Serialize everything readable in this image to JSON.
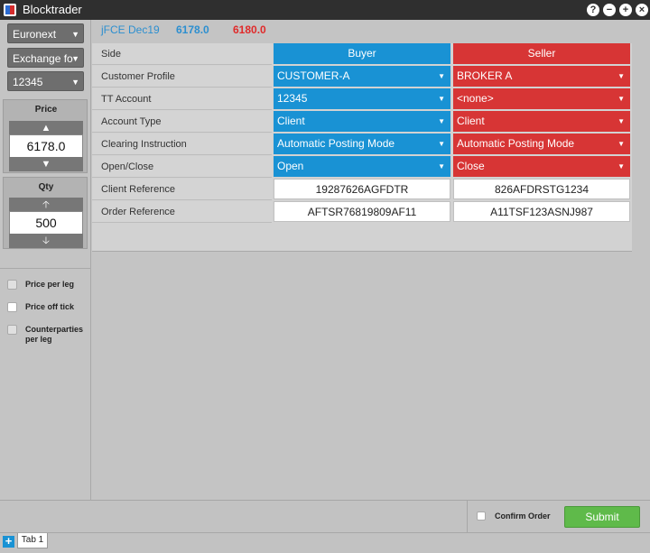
{
  "window": {
    "title": "Blocktrader",
    "controls": [
      "?",
      "−",
      "+",
      "×"
    ]
  },
  "sidebar": {
    "exchange_select": "Euronext",
    "type_select": "Exchange fo",
    "account_select": "12345",
    "price_label": "Price",
    "price_value": "6178.0",
    "qty_label": "Qty",
    "qty_value": "500",
    "options": [
      {
        "label": "Price per leg",
        "checked": false
      },
      {
        "label": "Price off tick",
        "checked": false
      },
      {
        "label": "Counterparties per leg",
        "checked": false
      }
    ]
  },
  "instrument": {
    "name": "jFCE Dec19",
    "bid": "6178.0",
    "ask": "6180.0"
  },
  "form": {
    "side_label": "Side",
    "buyer_header": "Buyer",
    "seller_header": "Seller",
    "rows": [
      {
        "label": "Customer Profile",
        "buyer": "CUSTOMER-A",
        "seller": "BROKER A"
      },
      {
        "label": "TT Account",
        "buyer": "12345",
        "seller": "<none>"
      },
      {
        "label": "Account Type",
        "buyer": "Client",
        "seller": "Client"
      },
      {
        "label": "Clearing Instruction",
        "buyer": "Automatic Posting Mode",
        "seller": "Automatic Posting Mode"
      },
      {
        "label": "Open/Close",
        "buyer": "Open",
        "seller": "Close"
      },
      {
        "label": "Client Reference",
        "buyer": "19287626AGFDTR",
        "seller": "826AFDRSTG1234"
      },
      {
        "label": "Order Reference",
        "buyer": "AFTSR76819809AF11",
        "seller": "A11TSF123ASNJ987"
      }
    ]
  },
  "actions": {
    "confirm_label": "Confirm Order",
    "confirm_checked": false,
    "submit_label": "Submit"
  },
  "tabs": {
    "add_label": "+",
    "items": [
      "Tab 1"
    ]
  },
  "colors": {
    "buyer": "#1992d4",
    "seller": "#d73535",
    "submit": "#5fba4a"
  }
}
